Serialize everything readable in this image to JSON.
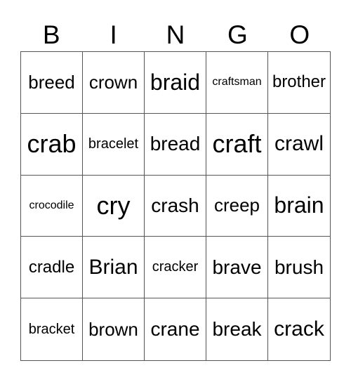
{
  "header": [
    "B",
    "I",
    "N",
    "G",
    "O"
  ],
  "cells": [
    "breed",
    "crown",
    "braid",
    "craftsman",
    "brother",
    "crab",
    "bracelet",
    "bread",
    "craft",
    "crawl",
    "crocodile",
    "cry",
    "crash",
    "creep",
    "brain",
    "cradle",
    "Brian",
    "cracker",
    "brave",
    "brush",
    "bracket",
    "brown",
    "crane",
    "break",
    "crack"
  ]
}
